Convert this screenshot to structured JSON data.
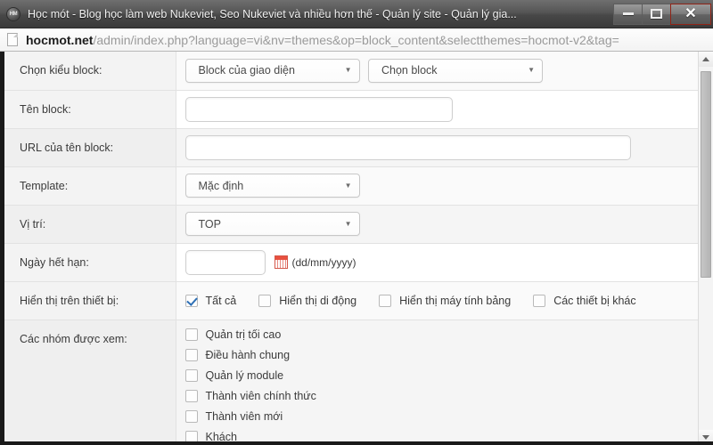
{
  "window": {
    "title": "Học mót - Blog học làm web Nukeviet, Seo Nukeviet và nhiều hơn thế - Quản lý site - Quản lý gia...",
    "favicon_text": "HM",
    "controls": {
      "minimize": "minimize-button",
      "maximize": "maximize-button",
      "close_glyph": "✕"
    }
  },
  "urlbar": {
    "host": "hocmot.net",
    "path": "/admin/index.php?language=vi&nv=themes&op=block_content&selectthemes=hocmot-v2&tag=",
    "page_icon": "page-icon"
  },
  "form": {
    "rows": [
      {
        "label": "Chọn kiểu block:",
        "select_1": "Block của giao diện",
        "select_2": "Chọn block",
        "caret": "▼"
      },
      {
        "label": "Tên block:"
      },
      {
        "label": "URL của tên block:"
      },
      {
        "label": "Template:",
        "select_1": "Mặc định",
        "caret": "▼"
      },
      {
        "label": "Vị trí:",
        "select_1": "TOP",
        "caret": "▼"
      },
      {
        "label": "Ngày hết hạn:",
        "date_value": "",
        "date_hint": "(dd/mm/yyyy)"
      },
      {
        "label": "Hiển thị trên thiết bị:"
      },
      {
        "label": "Các nhóm được xem:"
      }
    ],
    "inputs": {
      "block_name_value": "",
      "block_url_value": "",
      "expire_date_value": ""
    },
    "devices": [
      {
        "label": "Tất cả",
        "checked": true
      },
      {
        "label": "Hiển thị di động",
        "checked": false
      },
      {
        "label": "Hiển thị máy tính bảng",
        "checked": false
      },
      {
        "label": "Các thiết bị khác",
        "checked": false
      }
    ],
    "groups": [
      {
        "label": "Quản trị tối cao",
        "checked": false
      },
      {
        "label": "Điều hành chung",
        "checked": false
      },
      {
        "label": "Quản lý module",
        "checked": false
      },
      {
        "label": "Thành viên chính thức",
        "checked": false
      },
      {
        "label": "Thành viên mới",
        "checked": false
      },
      {
        "label": "Khách",
        "checked": false
      }
    ]
  },
  "scrollbar": {
    "up_arrow": "scroll-up-arrow",
    "down_arrow": "scroll-down-arrow"
  },
  "colors": {
    "close_button": "#c9402e",
    "checkbox_check": "#2d6fb5",
    "calendar_icon": "#e8503f",
    "label_column": "#f3f3f3"
  }
}
